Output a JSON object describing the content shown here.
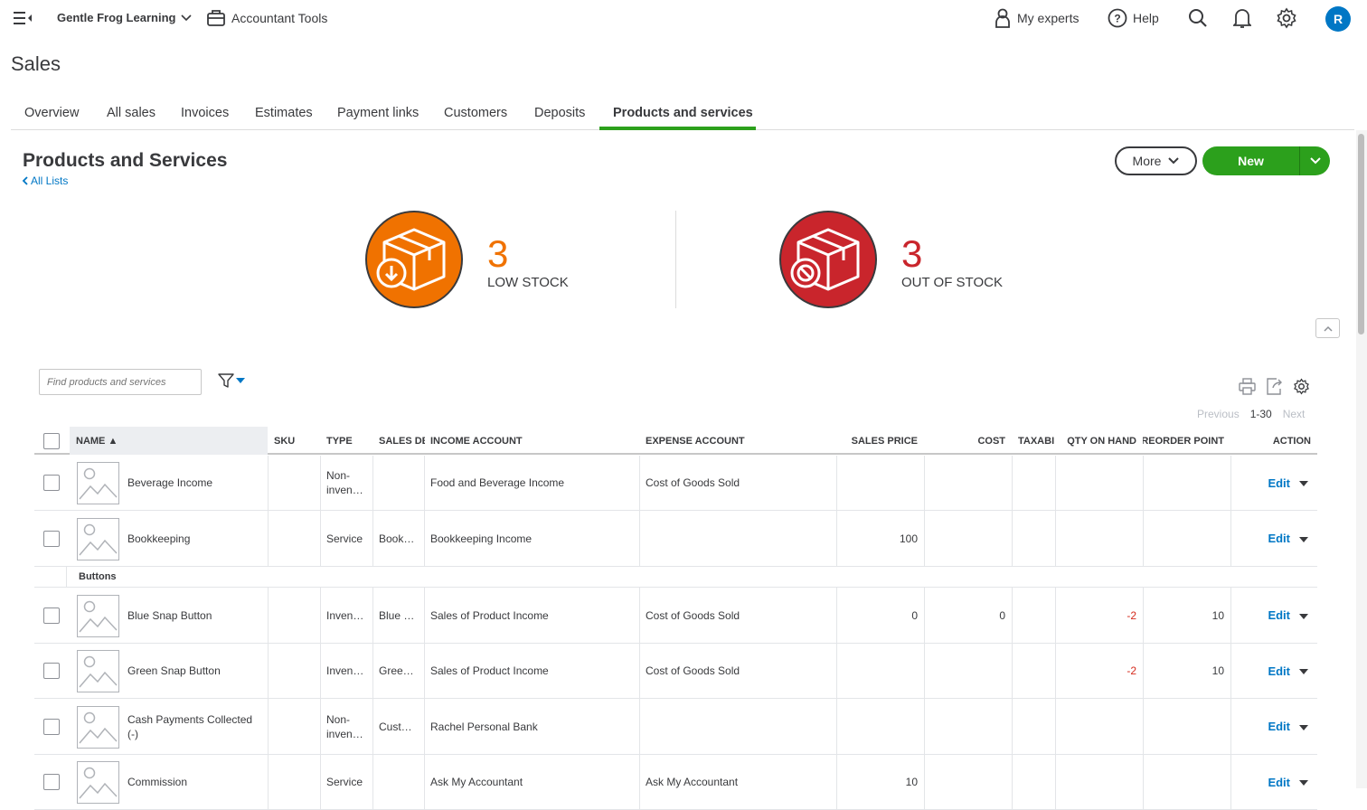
{
  "topbar": {
    "company": "Gentle Frog Learning",
    "accountant_tools": "Accountant Tools",
    "my_experts": "My experts",
    "help": "Help",
    "avatar_initial": "R"
  },
  "page": {
    "title": "Sales"
  },
  "tabs": [
    "Overview",
    "All sales",
    "Invoices",
    "Estimates",
    "Payment links",
    "Customers",
    "Deposits",
    "Products and services"
  ],
  "active_tab": "Products and services",
  "section": {
    "title": "Products and Services",
    "back_link": "All Lists",
    "more_label": "More",
    "new_label": "New"
  },
  "stock": {
    "low": {
      "count": "3",
      "label": "LOW STOCK",
      "color": "#f07200"
    },
    "out": {
      "count": "3",
      "label": "OUT OF STOCK",
      "color": "#c9252c"
    }
  },
  "search": {
    "placeholder": "Find products and services"
  },
  "pager": {
    "previous": "Previous",
    "range": "1-30",
    "next": "Next"
  },
  "table": {
    "headers": {
      "name": "NAME ▲",
      "sku": "SKU",
      "type": "TYPE",
      "sales_desc": "SALES DE",
      "income": "INCOME ACCOUNT",
      "expense": "EXPENSE ACCOUNT",
      "price": "SALES PRICE",
      "cost": "COST",
      "taxable": "TAXABI",
      "qty": "QTY ON HAND",
      "reorder": "REORDER POINT",
      "action": "ACTION"
    },
    "group_label": "Buttons",
    "edit_label": "Edit",
    "rows": [
      {
        "name": "Beverage Income",
        "sku": "",
        "type": "Non-inven…",
        "desc": "",
        "income": "Food and Beverage Income",
        "expense": "Cost of Goods Sold",
        "price": "",
        "cost": "",
        "taxable": "",
        "qty": "",
        "reorder": ""
      },
      {
        "name": "Bookkeeping",
        "sku": "",
        "type": "Service",
        "desc": "Book…",
        "income": "Bookkeeping Income",
        "expense": "",
        "price": "100",
        "cost": "",
        "taxable": "",
        "qty": "",
        "reorder": ""
      },
      {
        "name": "Blue Snap Button",
        "sku": "",
        "type": "Inven…",
        "desc": "Blue …",
        "income": "Sales of Product Income",
        "expense": "Cost of Goods Sold",
        "price": "0",
        "cost": "0",
        "taxable": "",
        "qty": "-2",
        "reorder": "10"
      },
      {
        "name": "Green Snap Button",
        "sku": "",
        "type": "Inven…",
        "desc": "Gree…",
        "income": "Sales of Product Income",
        "expense": "Cost of Goods Sold",
        "price": "",
        "cost": "",
        "taxable": "",
        "qty": "-2",
        "reorder": "10"
      },
      {
        "name": "Cash Payments Collected (-)",
        "sku": "",
        "type": "Non-inven…",
        "desc": "Cust…",
        "income": "Rachel Personal Bank",
        "expense": "",
        "price": "",
        "cost": "",
        "taxable": "",
        "qty": "",
        "reorder": ""
      },
      {
        "name": "Commission",
        "sku": "",
        "type": "Service",
        "desc": "",
        "income": "Ask My Accountant",
        "expense": "Ask My Accountant",
        "price": "10",
        "cost": "",
        "taxable": "",
        "qty": "",
        "reorder": ""
      }
    ]
  }
}
